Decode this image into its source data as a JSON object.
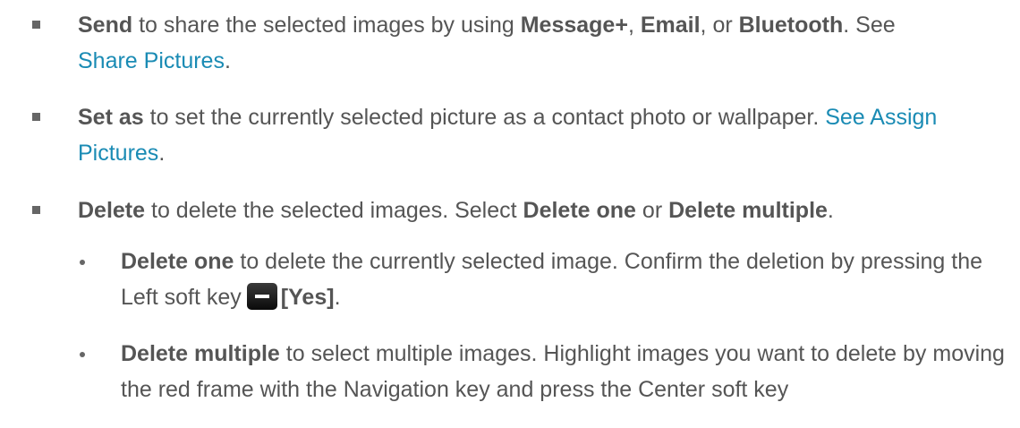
{
  "items": [
    {
      "term": "Send",
      "text1": " to share the selected images by using ",
      "opt1": "Message+",
      "sep1": ", ",
      "opt2": "Email",
      "sep2": ", or ",
      "opt3": "Bluetooth",
      "sep3": ". See ",
      "link": "Share Pictures",
      "end": "."
    },
    {
      "term": "Set as",
      "text1": " to set the currently selected picture as a contact photo or wallpaper. ",
      "link": "See Assign Pictures",
      "end": "."
    },
    {
      "term": "Delete",
      "text1": " to delete the selected images. Select ",
      "opt1": "Delete one",
      "sep1": " or ",
      "opt2": "Delete multiple",
      "end": "."
    }
  ],
  "subitems": [
    {
      "term": "Delete one",
      "text1": " to delete the currently selected image. Confirm the deletion by pressing the Left soft key",
      "key_icon": "left-soft-key-icon",
      "key_label": "[Yes]",
      "end": "."
    },
    {
      "term": "Delete multiple",
      "text1": " to select multiple images. Highlight images you want to delete by moving the red frame with the Navigation key and press the Center soft key"
    }
  ]
}
